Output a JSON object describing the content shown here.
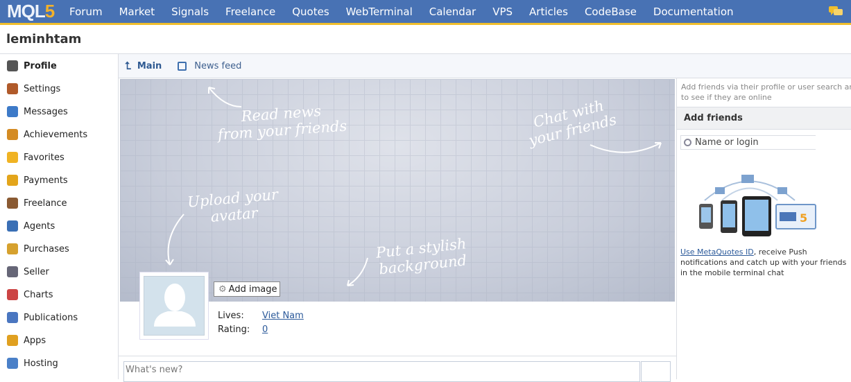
{
  "nav": {
    "logo": "MQL",
    "logo_num": "5",
    "items": [
      "Forum",
      "Market",
      "Signals",
      "Freelance",
      "Quotes",
      "WebTerminal",
      "Calendar",
      "VPS",
      "Articles",
      "CodeBase",
      "Documentation"
    ]
  },
  "username": "leminhtam",
  "sidebar": {
    "items": [
      {
        "label": "Profile",
        "icon": "user-icon",
        "color": "#555"
      },
      {
        "label": "Settings",
        "icon": "settings-icon",
        "color": "#b05a2a"
      },
      {
        "label": "Messages",
        "icon": "messages-icon",
        "color": "#3d7ac8"
      },
      {
        "label": "Achievements",
        "icon": "medal-icon",
        "color": "#d48b23"
      },
      {
        "label": "Favorites",
        "icon": "star-icon",
        "color": "#f0b323"
      },
      {
        "label": "Payments",
        "icon": "coins-icon",
        "color": "#e3a51b"
      },
      {
        "label": "Freelance",
        "icon": "briefcase-icon",
        "color": "#8a5a32"
      },
      {
        "label": "Agents",
        "icon": "gear-icon",
        "color": "#3a6fb5"
      },
      {
        "label": "Purchases",
        "icon": "purchases-icon",
        "color": "#d6a12e"
      },
      {
        "label": "Seller",
        "icon": "seller-icon",
        "color": "#667"
      },
      {
        "label": "Charts",
        "icon": "chart-icon",
        "color": "#c44"
      },
      {
        "label": "Publications",
        "icon": "publications-icon",
        "color": "#4a76c0"
      },
      {
        "label": "Apps",
        "icon": "apps-icon",
        "color": "#e0a020"
      },
      {
        "label": "Hosting",
        "icon": "hosting-icon",
        "color": "#4a80c8"
      }
    ]
  },
  "tabs": {
    "main": "Main",
    "news_feed": "News feed"
  },
  "cover": {
    "read_news": [
      "Read news",
      "from your friends"
    ],
    "chat": [
      "Chat with",
      "your friends"
    ],
    "upload": [
      "Upload your",
      "avatar"
    ],
    "background": [
      "Put a stylish",
      "background"
    ],
    "add_image": "Add image"
  },
  "profile": {
    "lives_label": "Lives:",
    "lives_value": "Viet Nam",
    "rating_label": "Rating:",
    "rating_value": "0"
  },
  "whats_new_placeholder": "What's new?",
  "right": {
    "hint": [
      "Add friends via their profile or user search and",
      "to see if they are online"
    ],
    "add_friends": "Add friends",
    "search_placeholder": "Name or login",
    "promo_link": "Use MetaQuotes ID",
    "promo_text": ", receive Push notifications and catch up with your friends in the mobile terminal chat"
  },
  "colors": {
    "nav_bg": "#4872b4",
    "nav_accent": "#f0be2c",
    "link": "#2c5a9a"
  }
}
